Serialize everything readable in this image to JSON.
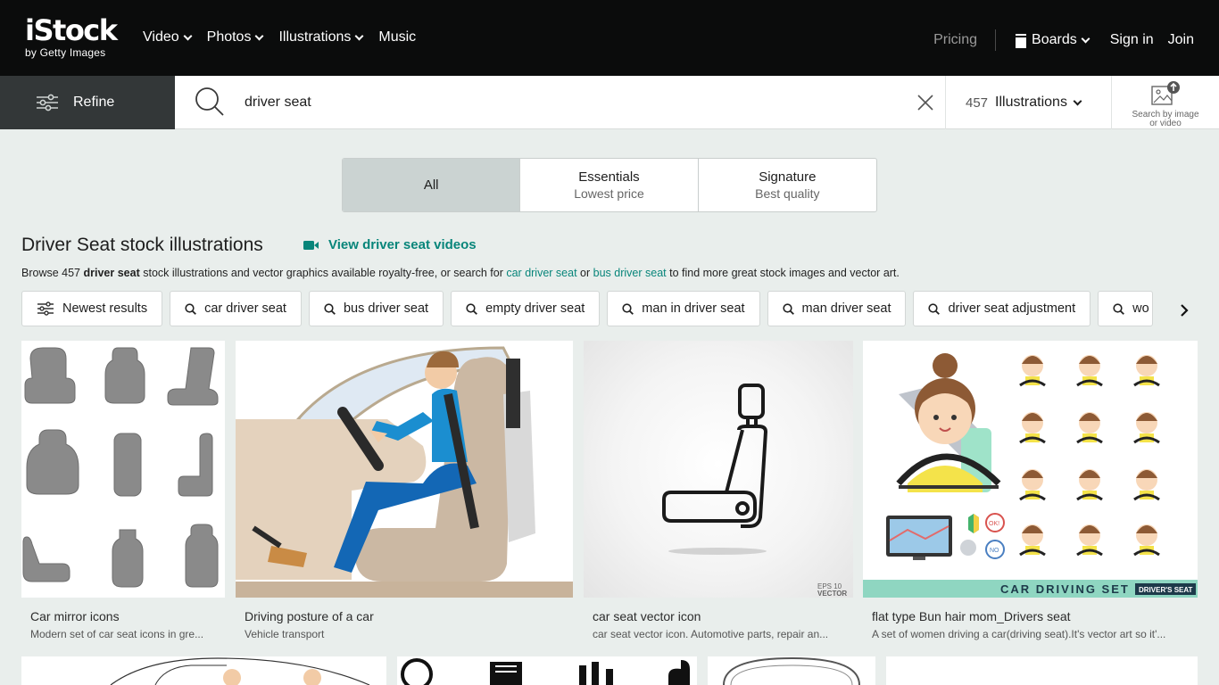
{
  "brand": {
    "name": "iStock",
    "tagline": "by Getty Images"
  },
  "nav": {
    "items": [
      {
        "label": "Video",
        "dropdown": true
      },
      {
        "label": "Photos",
        "dropdown": true
      },
      {
        "label": "Illustrations",
        "dropdown": true
      },
      {
        "label": "Music",
        "dropdown": false
      }
    ],
    "pricing": "Pricing",
    "boards": "Boards",
    "signin": "Sign in",
    "join": "Join"
  },
  "search": {
    "refine_label": "Refine",
    "query": "driver seat",
    "result_count": "457",
    "asset_type": "Illustrations",
    "image_search_label": "Search by image or video"
  },
  "segments": [
    {
      "label": "All",
      "sub": ""
    },
    {
      "label": "Essentials",
      "sub": "Lowest price"
    },
    {
      "label": "Signature",
      "sub": "Best quality"
    }
  ],
  "heading": {
    "title": "Driver Seat stock illustrations",
    "video_link": "View driver seat videos"
  },
  "browse": {
    "prefix": "Browse 457",
    "term": "driver seat",
    "middle": "stock illustrations and vector graphics available royalty-free, or search for",
    "link1": "car driver seat",
    "or": "or",
    "link2": "bus driver seat",
    "suffix": "to find more great stock images and vector art."
  },
  "chips": [
    "Newest results",
    "car driver seat",
    "bus driver seat",
    "empty driver seat",
    "man in driver seat",
    "man driver seat",
    "driver seat adjustment",
    "wo"
  ],
  "results": [
    {
      "title": "Car mirror icons",
      "desc": "Modern set of car seat icons in gre..."
    },
    {
      "title": "Driving posture of a car",
      "desc": "Vehicle transport"
    },
    {
      "title": "car seat vector icon",
      "desc": "car seat vector icon. Automotive parts, repair an..."
    },
    {
      "title": "flat type Bun hair mom_Drivers seat",
      "desc": "A set of women driving a car(driving seat).It's vector art so it'..."
    }
  ],
  "overlays": {
    "eps_badge": "EPS 10",
    "eps_badge2": "VECTOR",
    "car_set_banner": "CAR DRIVING SET",
    "car_set_tag": "DRIVER'S SEAT",
    "badge_ok": "OK!",
    "badge_no": "NO"
  },
  "colors": {
    "accent": "#08857a",
    "topbar": "#0b0c0c",
    "refine_bg": "#333738",
    "page_bg": "#e9eeec"
  }
}
